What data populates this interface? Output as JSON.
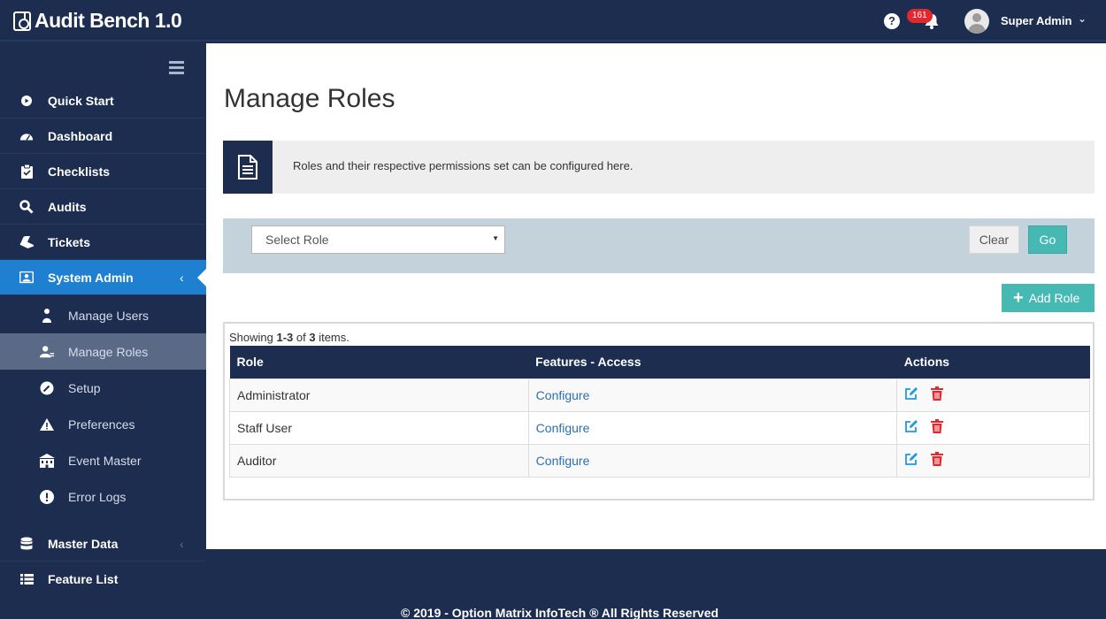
{
  "app": {
    "title": "Audit Bench 1.0"
  },
  "topbar": {
    "help_symbol": "?",
    "notification_count": "161",
    "user_name": "Super Admin",
    "user_caret": "⌄"
  },
  "sidebar": {
    "items": [
      {
        "label": "Quick Start",
        "icon": "play-circle-icon"
      },
      {
        "label": "Dashboard",
        "icon": "speedometer-icon"
      },
      {
        "label": "Checklists",
        "icon": "clipboard-icon"
      },
      {
        "label": "Audits",
        "icon": "search-icon"
      },
      {
        "label": "Tickets",
        "icon": "ticket-icon"
      },
      {
        "label": "System Admin",
        "icon": "admin-icon",
        "active": true
      },
      {
        "label": "Master Data",
        "icon": "database-icon"
      },
      {
        "label": "Feature List",
        "icon": "list-icon"
      }
    ],
    "sub_items": [
      {
        "label": "Manage Users",
        "icon": "users-icon"
      },
      {
        "label": "Manage Roles",
        "icon": "user-roles-icon",
        "selected": true
      },
      {
        "label": "Setup",
        "icon": "setup-icon"
      },
      {
        "label": "Preferences",
        "icon": "warning-icon"
      },
      {
        "label": "Event Master",
        "icon": "building-icon"
      },
      {
        "label": "Error Logs",
        "icon": "alert-icon"
      }
    ]
  },
  "page": {
    "title": "Manage Roles",
    "info_text": "Roles and their respective permissions set can be configured here."
  },
  "filter": {
    "select_value": "Select Role",
    "clear_label": "Clear",
    "go_label": "Go"
  },
  "actions": {
    "add_role_label": "Add Role"
  },
  "grid": {
    "summary": {
      "prefix": "Showing ",
      "range": "1-3",
      "of": " of ",
      "total": "3",
      "suffix": " items."
    },
    "headers": [
      "Role",
      "Features - Access",
      "Actions"
    ],
    "rows": [
      {
        "role": "Administrator",
        "feature_link": "Configure"
      },
      {
        "role": "Staff User",
        "feature_link": "Configure"
      },
      {
        "role": "Auditor",
        "feature_link": "Configure"
      }
    ]
  },
  "footer": {
    "text": "© 2019 - Option Matrix InfoTech ® All Rights Reserved"
  },
  "colors": {
    "navy": "#1c2d4f",
    "active_blue": "#1f7fd1",
    "teal": "#47b9b3",
    "danger": "#e0282e",
    "link": "#2a6fb0",
    "filter_bg": "#c3d2db"
  }
}
